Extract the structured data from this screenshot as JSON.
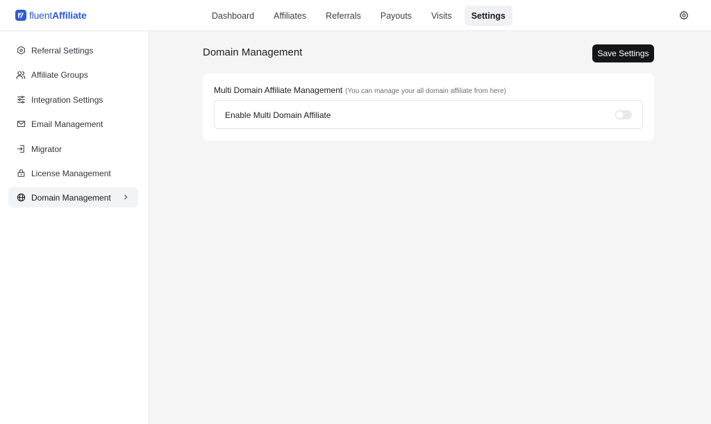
{
  "brand": {
    "name_light": "fluent",
    "name_bold": "Affiliate",
    "accent": "#2f5bd6"
  },
  "nav": {
    "tabs": [
      {
        "label": "Dashboard",
        "active": false
      },
      {
        "label": "Affiliates",
        "active": false
      },
      {
        "label": "Referrals",
        "active": false
      },
      {
        "label": "Payouts",
        "active": false
      },
      {
        "label": "Visits",
        "active": false
      },
      {
        "label": "Settings",
        "active": true
      }
    ],
    "settings_icon": "gear-icon"
  },
  "sidebar": {
    "items": [
      {
        "label": "Referral Settings",
        "icon": "hexagon-icon",
        "active": false
      },
      {
        "label": "Affiliate Groups",
        "icon": "users-icon",
        "active": false
      },
      {
        "label": "Integration Settings",
        "icon": "sliders-icon",
        "active": false
      },
      {
        "label": "Email Management",
        "icon": "mail-icon",
        "active": false
      },
      {
        "label": "Migrator",
        "icon": "import-icon",
        "active": false
      },
      {
        "label": "License Management",
        "icon": "lock-icon",
        "active": false
      },
      {
        "label": "Domain Management",
        "icon": "globe-icon",
        "active": true
      }
    ]
  },
  "main": {
    "title": "Domain Management",
    "save_label": "Save Settings",
    "section": {
      "title": "Multi Domain Affiliate Management",
      "hint": "(You can manage your all domain affiliate from here)",
      "option_label": "Enable Multi Domain Affiliate",
      "option_enabled": false
    }
  }
}
